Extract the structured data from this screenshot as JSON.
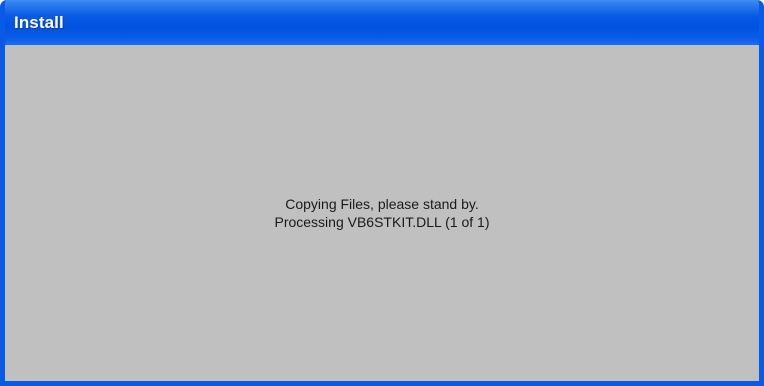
{
  "window": {
    "title": "Install"
  },
  "content": {
    "status_line_1": "Copying Files, please stand by.",
    "status_line_2": "Processing VB6STKIT.DLL (1 of 1)"
  },
  "colors": {
    "titlebar": "#0A5AE6",
    "client_background": "#C0C0C0",
    "title_text": "#FFFFFF"
  }
}
